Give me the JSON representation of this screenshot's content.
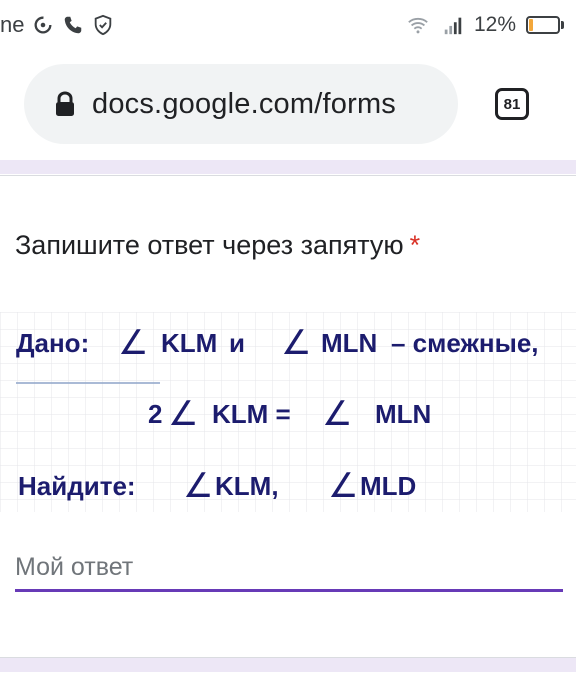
{
  "status_bar": {
    "carrier_fragment": "ne",
    "battery_percent": "12%",
    "battery_level": 0.12,
    "icons": [
      "data-saver-icon",
      "phone-icon",
      "shield-check-icon",
      "wifi-icon",
      "signal-icon",
      "battery-icon"
    ]
  },
  "browser": {
    "url": "docs.google.com/forms",
    "tab_count": "81"
  },
  "question": {
    "title": "Запишите ответ через запятую",
    "required_mark": "*"
  },
  "problem": {
    "given_label": "Дано:",
    "line1_angle1": "KLM",
    "line1_and": "и",
    "line1_angle2": "MLN",
    "line1_suffix": "– смежные,",
    "line2_coefficient": "2",
    "line2_angle1": "KLM =",
    "line2_angle2": "MLN",
    "find_label": "Найдите:",
    "find_angle1": "KLM,",
    "find_angle2": "MLD",
    "angle_symbol": "∠"
  },
  "answer": {
    "placeholder": "Мой ответ",
    "value": ""
  },
  "colors": {
    "accent": "#673ab7",
    "required": "#d93025",
    "problem_text": "#1c1c6e",
    "band": "#ede7f6"
  }
}
